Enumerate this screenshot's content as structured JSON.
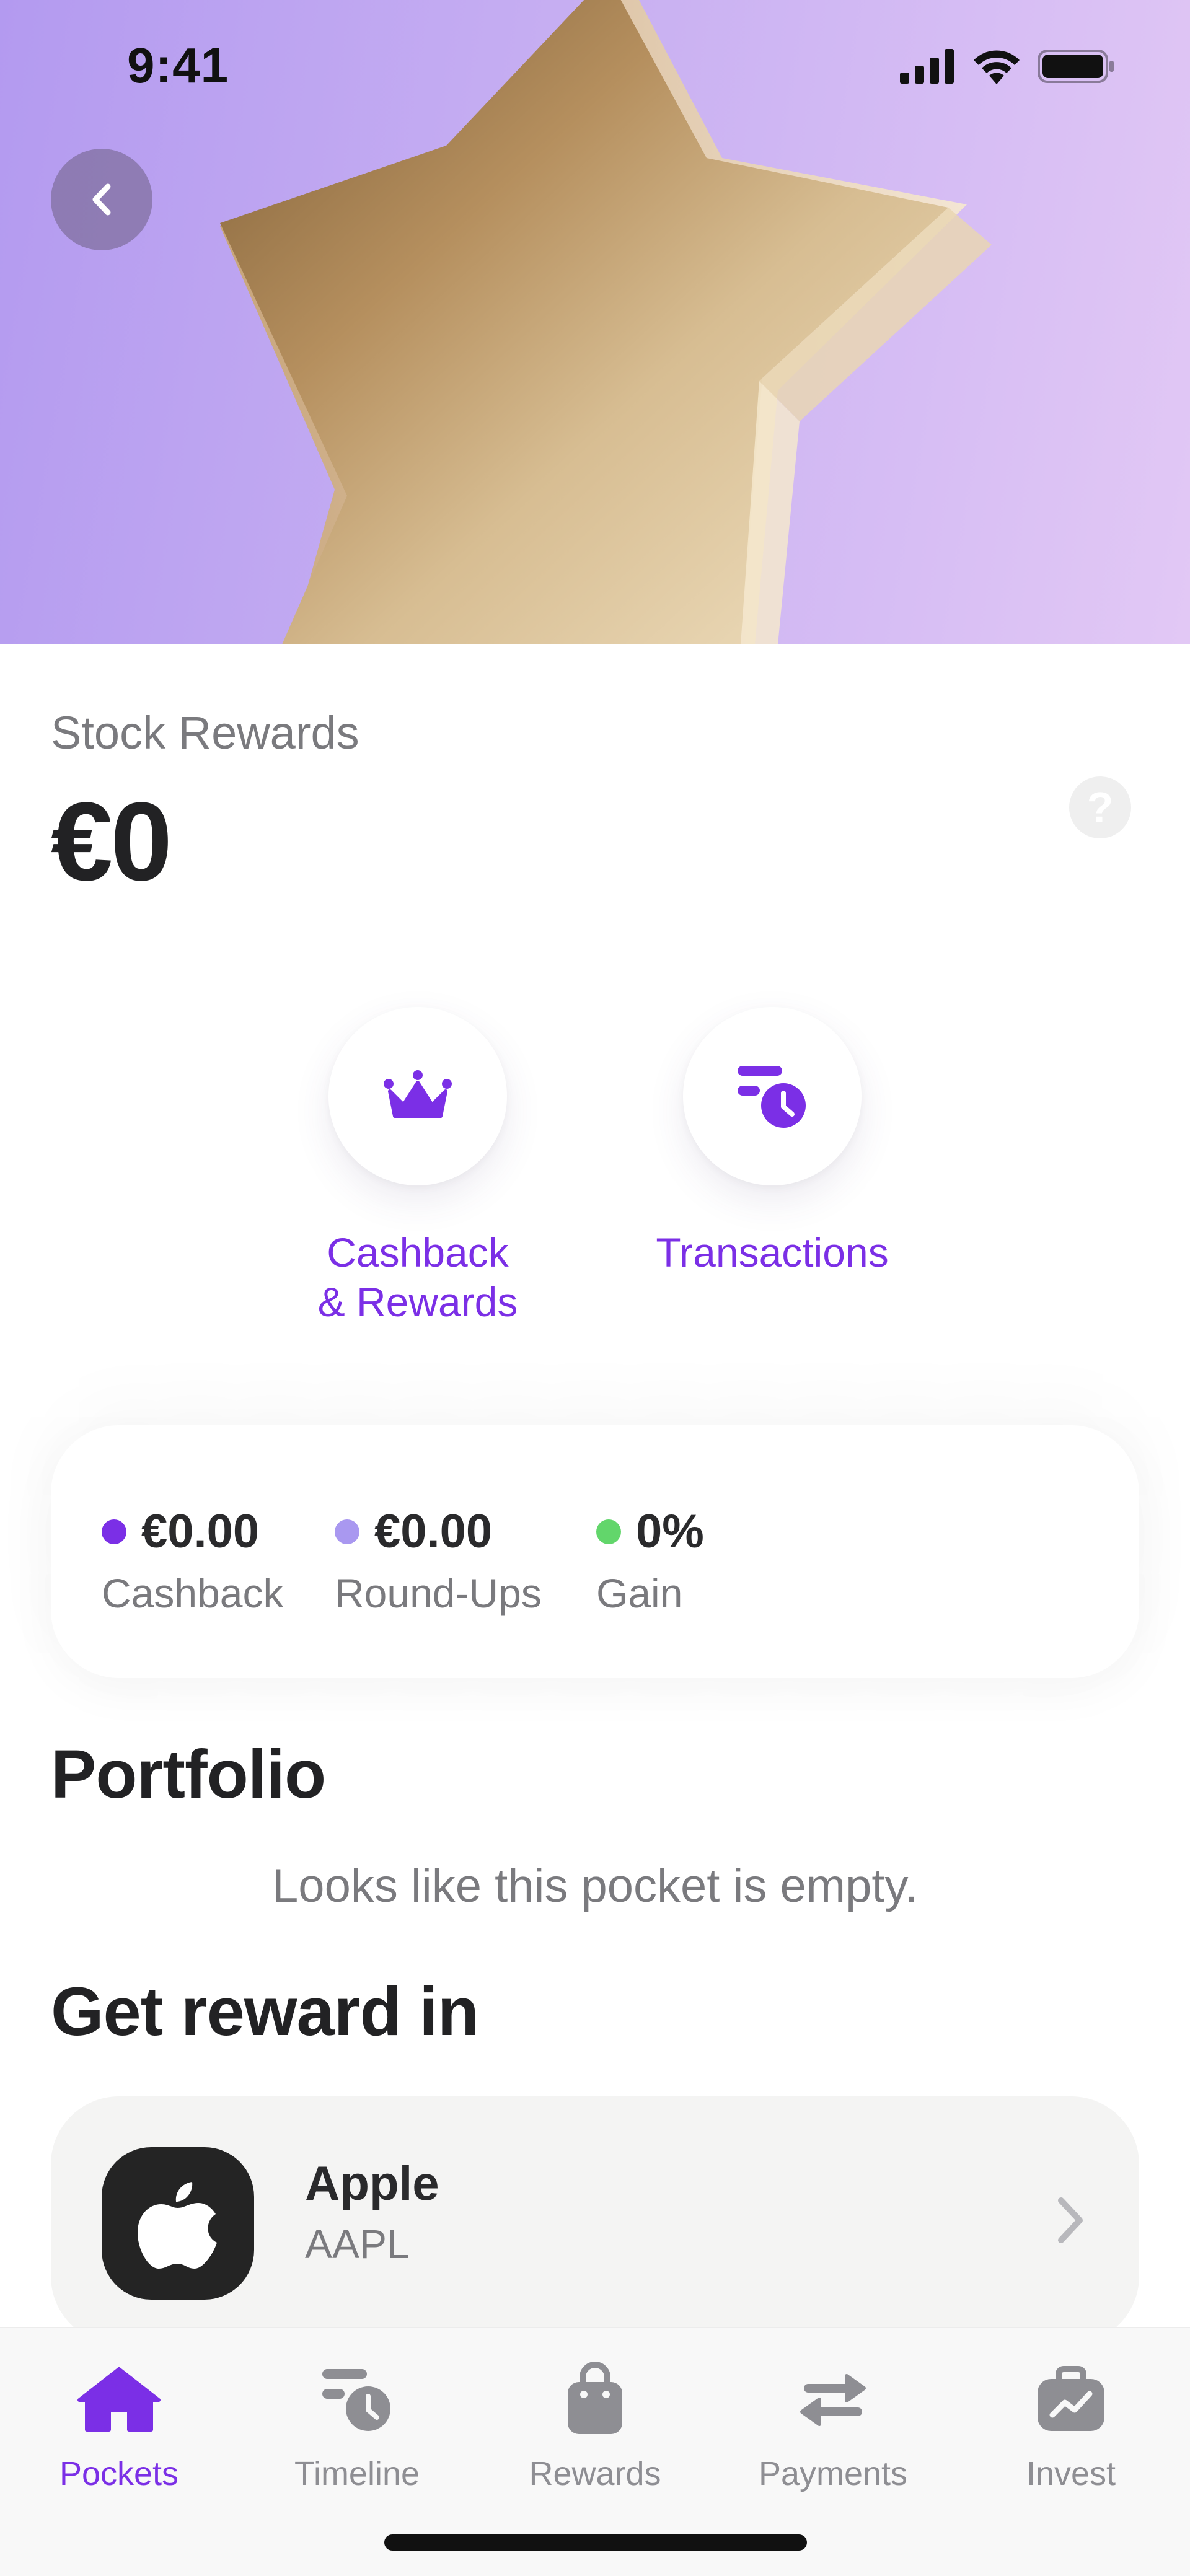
{
  "status_bar": {
    "time": "9:41"
  },
  "stock_rewards": {
    "title": "Stock Rewards",
    "balance": "€0",
    "help_label": "?"
  },
  "actions": [
    {
      "label": "Cashback\n& Rewards",
      "icon": "crown-icon"
    },
    {
      "label": "Transactions",
      "icon": "transactions-clock-icon"
    }
  ],
  "stats": [
    {
      "value": "€0.00",
      "label": "Cashback",
      "color": "#7b2fe6"
    },
    {
      "value": "€0.00",
      "label": "Round-Ups",
      "color": "#a998f0"
    },
    {
      "value": "0%",
      "label": "Gain",
      "color": "#62d66b"
    }
  ],
  "portfolio": {
    "title": "Portfolio",
    "empty_message": "Looks like this pocket is empty."
  },
  "get_reward": {
    "title": "Get reward in",
    "items": [
      {
        "name": "Apple",
        "ticker": "AAPL",
        "icon": "apple-logo-icon"
      }
    ]
  },
  "tab_bar": {
    "tabs": [
      {
        "label": "Pockets",
        "icon": "home-icon",
        "active": true
      },
      {
        "label": "Timeline",
        "icon": "timeline-icon",
        "active": false
      },
      {
        "label": "Rewards",
        "icon": "shopping-bag-icon",
        "active": false
      },
      {
        "label": "Payments",
        "icon": "arrows-exchange-icon",
        "active": false
      },
      {
        "label": "Invest",
        "icon": "briefcase-chart-icon",
        "active": false
      }
    ]
  },
  "colors": {
    "accent": "#7b2fe6",
    "hero_start": "#b39af0",
    "hero_end": "#e2c8f5",
    "inactive_tab": "#8e8e93"
  }
}
